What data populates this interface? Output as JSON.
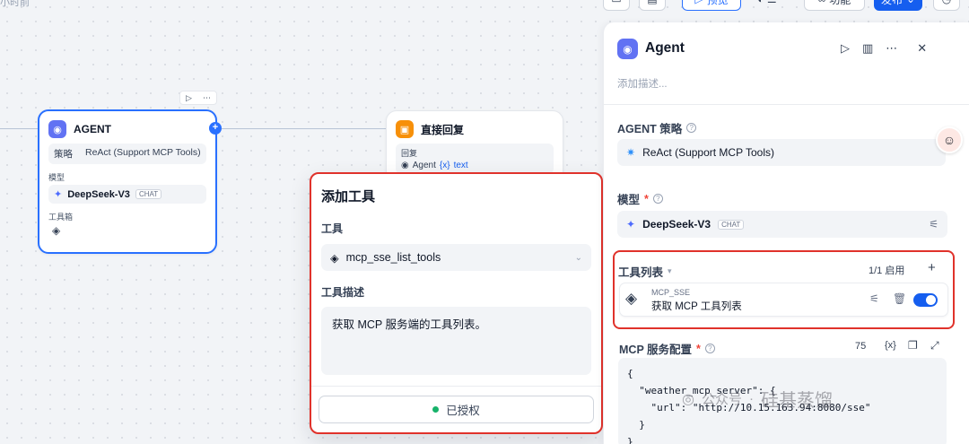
{
  "topbar": {
    "hint": "小时前",
    "preview_label": "预览",
    "features_label": "功能",
    "publish_label": "发布"
  },
  "canvas": {
    "agent_node": {
      "title": "AGENT",
      "strategy_label": "策略",
      "strategy_value": "ReAct (Support MCP Tools)",
      "model_label": "模型",
      "model_value": "DeepSeek-V3",
      "model_tag": "CHAT",
      "toolbox_label": "工具箱"
    },
    "reply_node": {
      "title": "直接回复",
      "reply_label": "回复",
      "source": "Agent",
      "var_symbol": "{x}",
      "var_name": "text"
    }
  },
  "add_tool_popup": {
    "title": "添加工具",
    "tool_label": "工具",
    "tool_value": "mcp_sse_list_tools",
    "desc_label": "工具描述",
    "desc_value": "获取 MCP 服务端的工具列表。",
    "auth_label": "已授权"
  },
  "panel": {
    "title": "Agent",
    "description_placeholder": "添加描述...",
    "strategy_label": "AGENT 策略",
    "strategy_value": "ReAct (Support MCP Tools)",
    "model_label": "模型",
    "model_value": "DeepSeek-V3",
    "model_tag": "CHAT",
    "tools_label": "工具列表",
    "tools_count": "1/1 启用",
    "tool_provider": "MCP_SSE",
    "tool_name": "获取 MCP 工具列表",
    "mcp_config_label": "MCP 服务配置",
    "mcp_config_chars": "75",
    "mcp_config_code": "{\n  \"weather_mcp_server\": {\n    \"url\": \"http://10.15.163.94:8080/sse\"\n  }\n}"
  },
  "watermark": {
    "platform": "公众号",
    "separator": "·",
    "name": "硅基蒸馏"
  },
  "colors": {
    "accent": "#155eef",
    "highlight_border": "#e0322b",
    "agent_icon": "#6172f3",
    "reply_icon": "#f79009",
    "authorized": "#17b26a"
  }
}
